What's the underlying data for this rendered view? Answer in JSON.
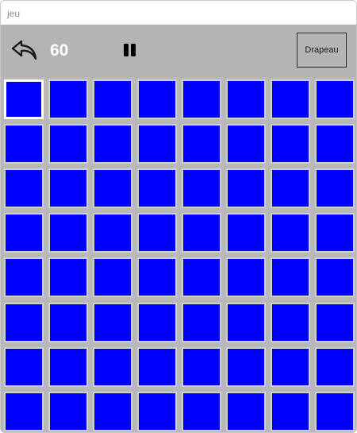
{
  "window": {
    "title": "jeu"
  },
  "toolbar": {
    "back_icon": "undo-arrow-icon",
    "counter": "60",
    "pause_icon": "pause-icon",
    "flag_label": "Drapeau"
  },
  "board": {
    "rows": 8,
    "cols": 8,
    "cell_color": "#0000ff",
    "selected_cell": {
      "row": 0,
      "col": 0
    }
  },
  "colors": {
    "toolbar_bg": "#b4b4b4",
    "board_bg": "#b8b8b8",
    "cell": "#0000ff",
    "counter_text": "#ffffff"
  }
}
